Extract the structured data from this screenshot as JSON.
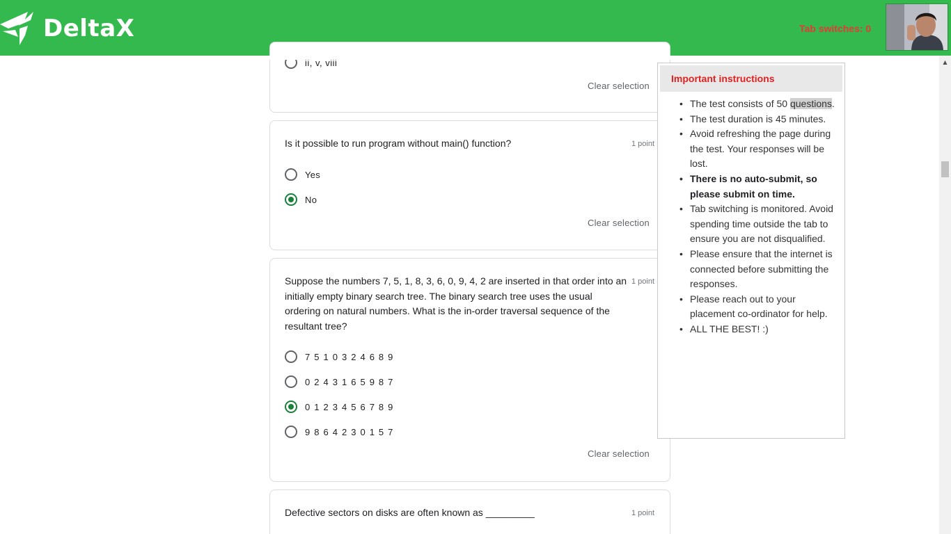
{
  "header": {
    "logo_text": "DeltaX",
    "tab_switches": "Tab switches: 0",
    "brand_color": "#33b94d"
  },
  "questions": [
    {
      "partial_option": "ii, v, viii",
      "clear_label": "Clear selection"
    },
    {
      "text": "Is it possible to run program without main() function?",
      "points": "1 point",
      "options": [
        {
          "label": "Yes",
          "selected": false
        },
        {
          "label": "No",
          "selected": true
        }
      ],
      "clear_label": "Clear selection"
    },
    {
      "text": "Suppose the numbers 7, 5, 1, 8, 3, 6, 0, 9, 4, 2 are inserted in that order into an initially empty binary search tree. The binary search tree uses the usual ordering on natural numbers. What is the in-order traversal sequence of the resultant tree?",
      "points": "1 point",
      "options": [
        {
          "label": "7 5 1 0 3 2 4 6 8 9",
          "selected": false
        },
        {
          "label": "0 2 4 3 1 6 5 9 8 7",
          "selected": false
        },
        {
          "label": "0 1 2 3 4 5 6 7 8 9",
          "selected": true
        },
        {
          "label": "9 8 6 4 2 3 0 1 5 7",
          "selected": false
        }
      ],
      "clear_label": "Clear selection"
    },
    {
      "text": "Defective sectors on disks are often known as _________",
      "points": "1 point"
    }
  ],
  "instructions": {
    "title": "Important instructions",
    "items": {
      "i0_pre": "The test consists of 50 ",
      "i0_hl": "questions",
      "i0_post": ".",
      "i1": "The test duration is 45 minutes.",
      "i2": "Avoid refreshing the page during the test. Your responses will be lost.",
      "i3": "There is no auto-submit, so please submit on time.",
      "i4": "Tab switching is monitored. Avoid spending time outside the tab to ensure you are not disqualified.",
      "i5": "Please ensure that the internet is connected before submitting the responses.",
      "i6": "Please reach out to your placement co-ordinator for help.",
      "i7": "ALL THE BEST! :)"
    }
  },
  "colors": {
    "selected_radio": "#188038",
    "instructions_title": "#e02020",
    "tab_switches": "#e53935"
  }
}
